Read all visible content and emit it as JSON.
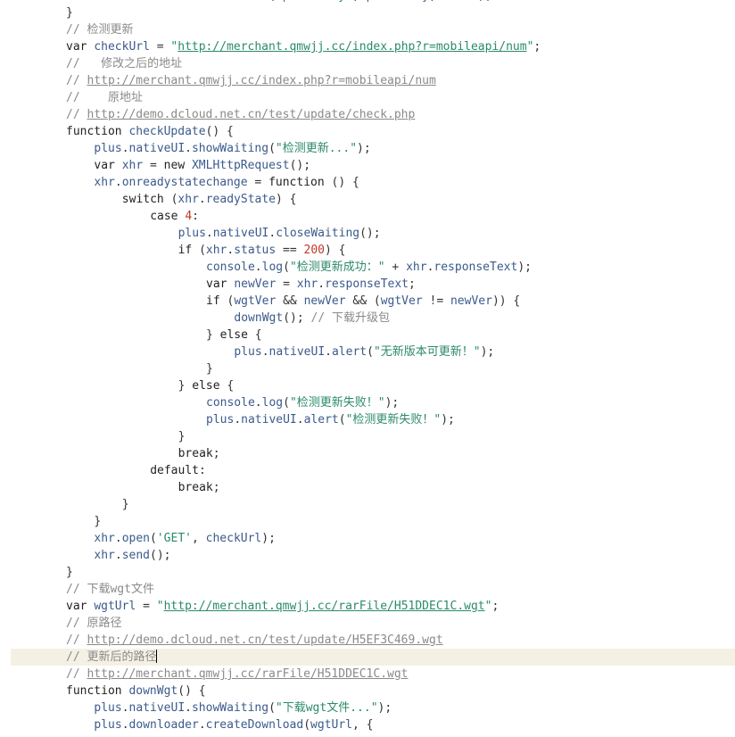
{
  "editor": {
    "lines": [
      {
        "indent": 4,
        "tokens": [
          [
            "obj",
            "document"
          ],
          [
            "op",
            "."
          ],
          [
            "fn",
            "addEventListener"
          ],
          [
            "op",
            "("
          ],
          [
            "str",
            "\"plusready\""
          ],
          [
            "op",
            ", "
          ],
          [
            "ident",
            "plusReady"
          ],
          [
            "op",
            ", "
          ],
          [
            "kw",
            "false"
          ],
          [
            "op",
            ");"
          ]
        ]
      },
      {
        "indent": 0,
        "tokens": [
          [
            "op",
            "}"
          ]
        ]
      },
      {
        "indent": 0,
        "tokens": [
          [
            "cmt",
            "// 检测更新"
          ]
        ]
      },
      {
        "indent": 0,
        "tokens": [
          [
            "kw",
            "var "
          ],
          [
            "ident",
            "checkUrl"
          ],
          [
            "op",
            " = "
          ],
          [
            "str",
            "\""
          ],
          [
            "url-str",
            "http://merchant.qmwjj.cc/index.php?r=mobileapi/num"
          ],
          [
            "str",
            "\""
          ],
          [
            "op",
            ";"
          ]
        ]
      },
      {
        "indent": 0,
        "tokens": [
          [
            "cmt",
            "//   修改之后的地址"
          ]
        ]
      },
      {
        "indent": 0,
        "tokens": [
          [
            "cmt",
            "// "
          ],
          [
            "url",
            "http://merchant.qmwjj.cc/index.php?r=mobileapi/num"
          ]
        ]
      },
      {
        "indent": 0,
        "tokens": [
          [
            "cmt",
            "//    原地址"
          ]
        ]
      },
      {
        "indent": 0,
        "tokens": [
          [
            "cmt",
            "// "
          ],
          [
            "url",
            "http://demo.dcloud.net.cn/test/update/check.php"
          ]
        ]
      },
      {
        "indent": 0,
        "tokens": [
          [
            "kw",
            "function "
          ],
          [
            "fn",
            "checkUpdate"
          ],
          [
            "op",
            "() {"
          ]
        ]
      },
      {
        "indent": 4,
        "tokens": [
          [
            "obj",
            "plus"
          ],
          [
            "op",
            "."
          ],
          [
            "obj",
            "nativeUI"
          ],
          [
            "op",
            "."
          ],
          [
            "fn",
            "showWaiting"
          ],
          [
            "op",
            "("
          ],
          [
            "str",
            "\"检测更新...\""
          ],
          [
            "op",
            ");"
          ]
        ]
      },
      {
        "indent": 4,
        "tokens": [
          [
            "kw",
            "var "
          ],
          [
            "ident",
            "xhr"
          ],
          [
            "op",
            " = "
          ],
          [
            "kw",
            "new "
          ],
          [
            "fn",
            "XMLHttpRequest"
          ],
          [
            "op",
            "();"
          ]
        ]
      },
      {
        "indent": 4,
        "tokens": [
          [
            "obj",
            "xhr"
          ],
          [
            "op",
            "."
          ],
          [
            "ident",
            "onreadystatechange"
          ],
          [
            "op",
            " = "
          ],
          [
            "kw",
            "function"
          ],
          [
            "op",
            " () {"
          ]
        ]
      },
      {
        "indent": 8,
        "tokens": [
          [
            "kw",
            "switch"
          ],
          [
            "op",
            " ("
          ],
          [
            "obj",
            "xhr"
          ],
          [
            "op",
            "."
          ],
          [
            "ident",
            "readyState"
          ],
          [
            "op",
            ") {"
          ]
        ]
      },
      {
        "indent": 12,
        "tokens": [
          [
            "kw",
            "case "
          ],
          [
            "num",
            "4"
          ],
          [
            "op",
            ":"
          ]
        ]
      },
      {
        "indent": 16,
        "tokens": [
          [
            "obj",
            "plus"
          ],
          [
            "op",
            "."
          ],
          [
            "obj",
            "nativeUI"
          ],
          [
            "op",
            "."
          ],
          [
            "fn",
            "closeWaiting"
          ],
          [
            "op",
            "();"
          ]
        ]
      },
      {
        "indent": 16,
        "tokens": [
          [
            "kw",
            "if"
          ],
          [
            "op",
            " ("
          ],
          [
            "obj",
            "xhr"
          ],
          [
            "op",
            "."
          ],
          [
            "ident",
            "status"
          ],
          [
            "op",
            " == "
          ],
          [
            "num",
            "200"
          ],
          [
            "op",
            ") {"
          ]
        ]
      },
      {
        "indent": 20,
        "tokens": [
          [
            "obj",
            "console"
          ],
          [
            "op",
            "."
          ],
          [
            "fn",
            "log"
          ],
          [
            "op",
            "("
          ],
          [
            "str",
            "\"检测更新成功：\""
          ],
          [
            "op",
            " + "
          ],
          [
            "obj",
            "xhr"
          ],
          [
            "op",
            "."
          ],
          [
            "ident",
            "responseText"
          ],
          [
            "op",
            ");"
          ]
        ]
      },
      {
        "indent": 20,
        "tokens": [
          [
            "kw",
            "var "
          ],
          [
            "ident",
            "newVer"
          ],
          [
            "op",
            " = "
          ],
          [
            "obj",
            "xhr"
          ],
          [
            "op",
            "."
          ],
          [
            "ident",
            "responseText"
          ],
          [
            "op",
            ";"
          ]
        ]
      },
      {
        "indent": 20,
        "tokens": [
          [
            "kw",
            "if"
          ],
          [
            "op",
            " ("
          ],
          [
            "ident",
            "wgtVer"
          ],
          [
            "op",
            " && "
          ],
          [
            "ident",
            "newVer"
          ],
          [
            "op",
            " && ("
          ],
          [
            "ident",
            "wgtVer"
          ],
          [
            "op",
            " != "
          ],
          [
            "ident",
            "newVer"
          ],
          [
            "op",
            ")) {"
          ]
        ]
      },
      {
        "indent": 24,
        "tokens": [
          [
            "fn",
            "downWgt"
          ],
          [
            "op",
            "(); "
          ],
          [
            "cmt",
            "// 下载升级包"
          ]
        ]
      },
      {
        "indent": 20,
        "tokens": [
          [
            "op",
            "} "
          ],
          [
            "kw",
            "else"
          ],
          [
            "op",
            " {"
          ]
        ]
      },
      {
        "indent": 24,
        "tokens": [
          [
            "obj",
            "plus"
          ],
          [
            "op",
            "."
          ],
          [
            "obj",
            "nativeUI"
          ],
          [
            "op",
            "."
          ],
          [
            "fn",
            "alert"
          ],
          [
            "op",
            "("
          ],
          [
            "str",
            "\"无新版本可更新！\""
          ],
          [
            "op",
            ");"
          ]
        ]
      },
      {
        "indent": 20,
        "tokens": [
          [
            "op",
            "}"
          ]
        ]
      },
      {
        "indent": 16,
        "tokens": [
          [
            "op",
            "} "
          ],
          [
            "kw",
            "else"
          ],
          [
            "op",
            " {"
          ]
        ]
      },
      {
        "indent": 20,
        "tokens": [
          [
            "obj",
            "console"
          ],
          [
            "op",
            "."
          ],
          [
            "fn",
            "log"
          ],
          [
            "op",
            "("
          ],
          [
            "str",
            "\"检测更新失败！\""
          ],
          [
            "op",
            ");"
          ]
        ]
      },
      {
        "indent": 20,
        "tokens": [
          [
            "obj",
            "plus"
          ],
          [
            "op",
            "."
          ],
          [
            "obj",
            "nativeUI"
          ],
          [
            "op",
            "."
          ],
          [
            "fn",
            "alert"
          ],
          [
            "op",
            "("
          ],
          [
            "str",
            "\"检测更新失败！\""
          ],
          [
            "op",
            ");"
          ]
        ]
      },
      {
        "indent": 16,
        "tokens": [
          [
            "op",
            "}"
          ]
        ]
      },
      {
        "indent": 16,
        "tokens": [
          [
            "kw",
            "break"
          ],
          [
            "op",
            ";"
          ]
        ]
      },
      {
        "indent": 12,
        "tokens": [
          [
            "kw",
            "default"
          ],
          [
            "op",
            ":"
          ]
        ]
      },
      {
        "indent": 16,
        "tokens": [
          [
            "kw",
            "break"
          ],
          [
            "op",
            ";"
          ]
        ]
      },
      {
        "indent": 8,
        "tokens": [
          [
            "op",
            "}"
          ]
        ]
      },
      {
        "indent": 4,
        "tokens": [
          [
            "op",
            "}"
          ]
        ]
      },
      {
        "indent": 4,
        "tokens": [
          [
            "obj",
            "xhr"
          ],
          [
            "op",
            "."
          ],
          [
            "fn",
            "open"
          ],
          [
            "op",
            "("
          ],
          [
            "str",
            "'GET'"
          ],
          [
            "op",
            ", "
          ],
          [
            "ident",
            "checkUrl"
          ],
          [
            "op",
            ");"
          ]
        ]
      },
      {
        "indent": 4,
        "tokens": [
          [
            "obj",
            "xhr"
          ],
          [
            "op",
            "."
          ],
          [
            "fn",
            "send"
          ],
          [
            "op",
            "();"
          ]
        ]
      },
      {
        "indent": 0,
        "tokens": [
          [
            "op",
            "}"
          ]
        ]
      },
      {
        "indent": 0,
        "tokens": [
          [
            "cmt",
            "// 下载wgt文件"
          ]
        ]
      },
      {
        "indent": 0,
        "tokens": [
          [
            "kw",
            "var "
          ],
          [
            "ident",
            "wgtUrl"
          ],
          [
            "op",
            " = "
          ],
          [
            "str",
            "\""
          ],
          [
            "url-str",
            "http://merchant.qmwjj.cc/rarFile/H51DDEC1C.wgt"
          ],
          [
            "str",
            "\""
          ],
          [
            "op",
            ";"
          ]
        ]
      },
      {
        "indent": 0,
        "tokens": [
          [
            "cmt",
            "// 原路径"
          ]
        ]
      },
      {
        "indent": 0,
        "tokens": [
          [
            "cmt",
            "// "
          ],
          [
            "url",
            "http://demo.dcloud.net.cn/test/update/H5EF3C469.wgt"
          ]
        ]
      },
      {
        "indent": 0,
        "current": true,
        "tokens": [
          [
            "cmt",
            "// 更新后的路径"
          ]
        ]
      },
      {
        "indent": 0,
        "tokens": [
          [
            "cmt",
            "// "
          ],
          [
            "url",
            "http://merchant.qmwjj.cc/rarFile/H51DDEC1C.wgt"
          ]
        ]
      },
      {
        "indent": 0,
        "tokens": [
          [
            "kw",
            "function "
          ],
          [
            "fn",
            "downWgt"
          ],
          [
            "op",
            "() {"
          ]
        ]
      },
      {
        "indent": 4,
        "tokens": [
          [
            "obj",
            "plus"
          ],
          [
            "op",
            "."
          ],
          [
            "obj",
            "nativeUI"
          ],
          [
            "op",
            "."
          ],
          [
            "fn",
            "showWaiting"
          ],
          [
            "op",
            "("
          ],
          [
            "str",
            "\"下载wgt文件...\""
          ],
          [
            "op",
            ");"
          ]
        ]
      },
      {
        "indent": 4,
        "tokens": [
          [
            "obj",
            "plus"
          ],
          [
            "op",
            "."
          ],
          [
            "obj",
            "downloader"
          ],
          [
            "op",
            "."
          ],
          [
            "fn",
            "createDownload"
          ],
          [
            "op",
            "("
          ],
          [
            "ident",
            "wgtUrl"
          ],
          [
            "op",
            ", {"
          ]
        ]
      }
    ]
  }
}
